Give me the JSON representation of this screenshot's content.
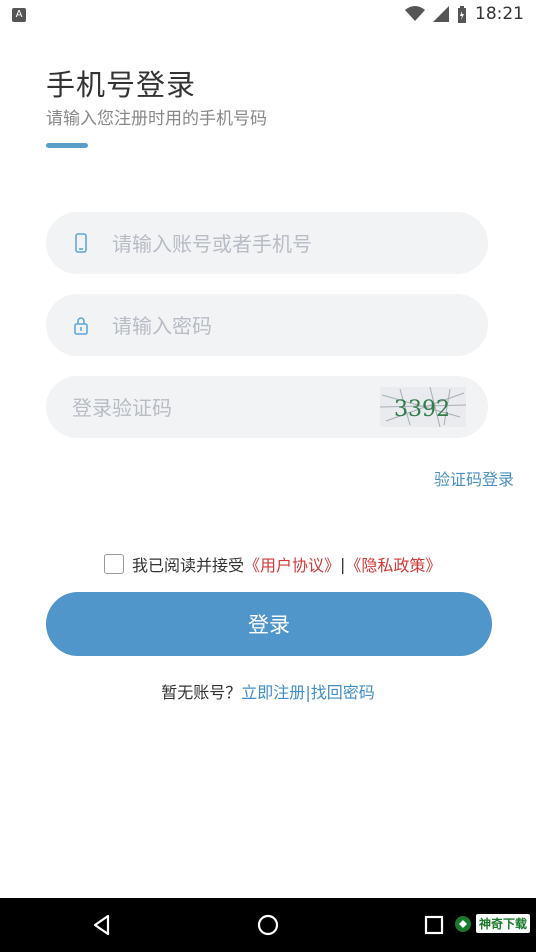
{
  "status_bar": {
    "time": "18:21"
  },
  "header": {
    "title": "手机号登录",
    "subtitle": "请输入您注册时用的手机号码"
  },
  "form": {
    "account_placeholder": "请输入账号或者手机号",
    "password_placeholder": "请输入密码",
    "code_placeholder": "登录验证码",
    "captcha_text": "3392",
    "code_login_label": "验证码登录"
  },
  "agreement": {
    "prefix": "我已阅读并接受",
    "user_agreement": "《用户协议》",
    "separator": " | ",
    "privacy_policy": "《隐私政策》"
  },
  "login_button": "登录",
  "bottom": {
    "no_account": "暂无账号？",
    "register": "立即注册",
    "divider": "|",
    "find_password": "找回密码"
  },
  "watermark": "神奇下载",
  "colors": {
    "accent": "#5196cb",
    "link": "#3f8ec6",
    "red": "#d03a3a"
  }
}
